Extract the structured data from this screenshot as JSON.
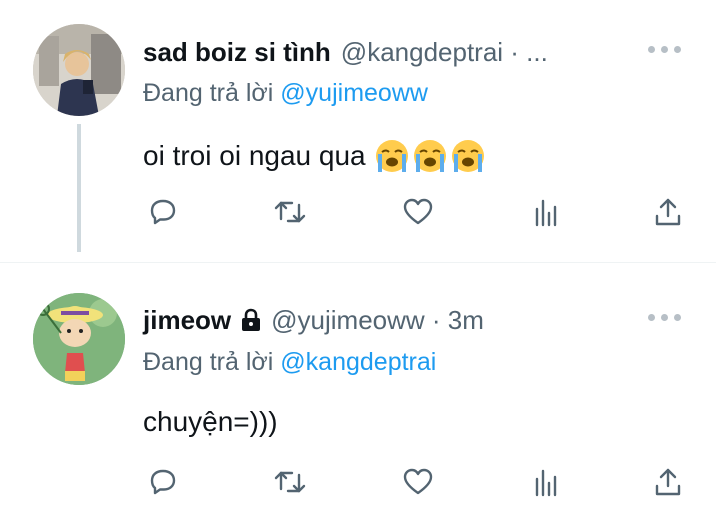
{
  "tweets": [
    {
      "display_name": "sad boiz si tình",
      "handle_line": "@kangdeptrai · ...",
      "reply_prefix": "Đang trả lời",
      "reply_to": "@yujimeoww",
      "text": "oi troi oi ngau qua",
      "emoji": [
        "loudly-crying-face",
        "loudly-crying-face",
        "loudly-crying-face"
      ],
      "protected": false
    },
    {
      "display_name": "jimeow",
      "handle_line": "@yujimeoww · 3m",
      "reply_prefix": "Đang trả lời",
      "reply_to": "@kangdeptrai",
      "text": "chuyện=)))",
      "protected": true
    }
  ],
  "actions": [
    "reply-icon",
    "retweet-icon",
    "like-icon",
    "views-icon",
    "share-icon"
  ],
  "colors": {
    "link": "#1d9bf0",
    "secondary": "#536471",
    "text": "#0f1419",
    "divider": "#eff3f4"
  }
}
